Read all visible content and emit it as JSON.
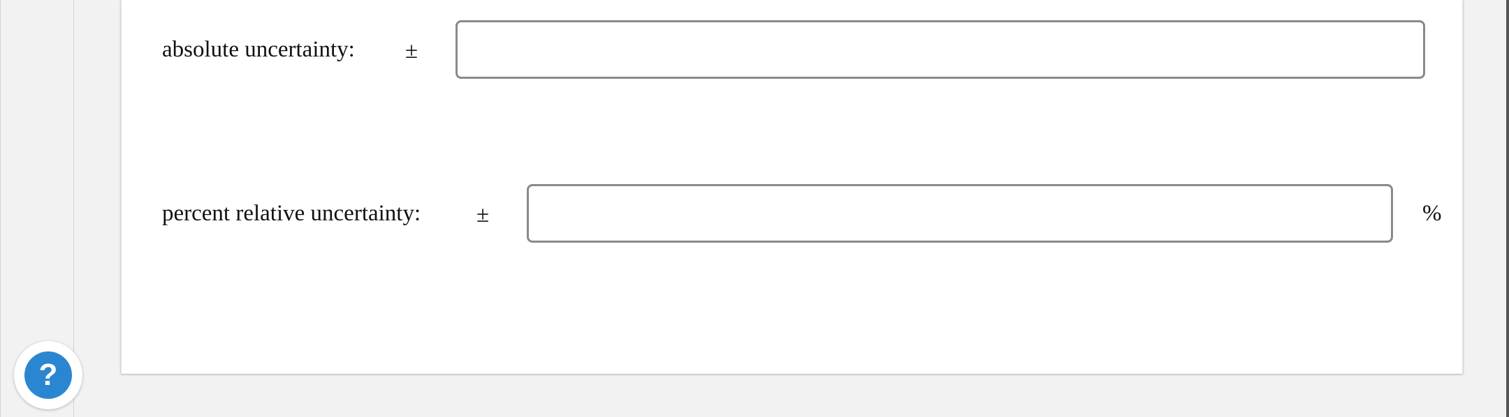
{
  "form": {
    "absolute": {
      "label": "absolute uncertainty:",
      "pm": "±",
      "value": ""
    },
    "percent": {
      "label": "percent relative uncertainty:",
      "pm": "±",
      "value": "",
      "unit": "%"
    }
  },
  "help": {
    "glyph": "?",
    "icon": "help-icon",
    "color": "#2a86d1"
  }
}
